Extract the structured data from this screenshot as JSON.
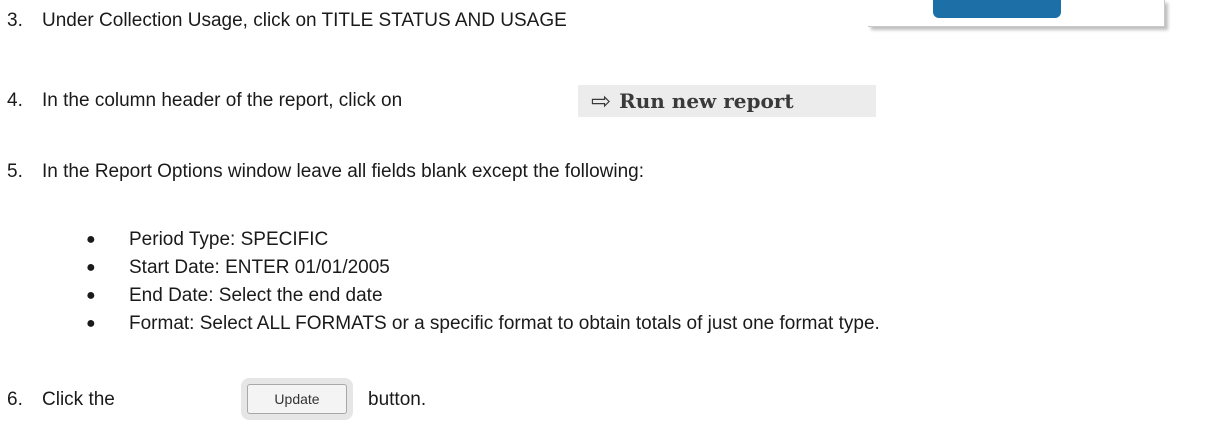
{
  "steps": [
    {
      "num": "3.",
      "text": "Under Collection Usage, click on TITLE STATUS AND USAGE"
    },
    {
      "num": "4.",
      "text": "In the column header of the report, click on"
    },
    {
      "num": "5.",
      "text": "In the Report Options window leave all fields blank except the following:"
    },
    {
      "num": "6.",
      "text_before": "Click the",
      "text_after": "button."
    }
  ],
  "bullets": [
    "Period Type: SPECIFIC",
    "Start Date: ENTER 01/01/2005",
    "End Date: Select the end date",
    "Format: Select ALL FORMATS or a specific format to obtain totals of just one format type."
  ],
  "run_report_button": {
    "label": "Run new report",
    "icon": "right-arrow-icon"
  },
  "update_button": {
    "label": "Update"
  },
  "colors": {
    "text": "#1a1a1a",
    "crop_button": "#1d6fa8",
    "run_report_bg": "#ececec"
  }
}
